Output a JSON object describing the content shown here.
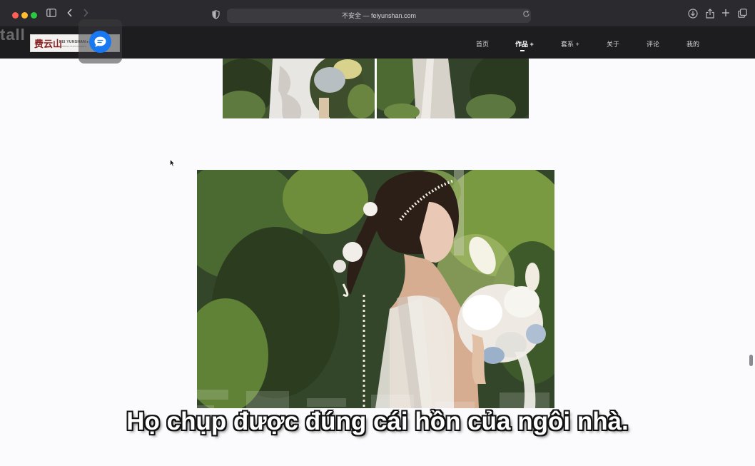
{
  "browser": {
    "url_text": "不安全 — feiyunshan.com",
    "icons": [
      "sidebar-icon",
      "back-icon",
      "forward-icon",
      "shield-icon",
      "reload-icon",
      "download-icon",
      "share-icon",
      "new-tab-icon",
      "tabs-overview-icon"
    ]
  },
  "site": {
    "overlay_text": "tall",
    "logo": {
      "cn": "费云山",
      "en": "FEI YUNSHAN ▸ ◆ ◆ ◆",
      "sub": "WEDDING PHOTOGRAPHY"
    },
    "nav": [
      {
        "label": "首页"
      },
      {
        "label": "作品 +"
      },
      {
        "label": "套系 +"
      },
      {
        "label": "关于"
      },
      {
        "label": "评论"
      },
      {
        "label": "我的"
      }
    ],
    "active_nav": "作品 +"
  },
  "subtitle": "Họ chụp được đúng cái hồn của ngôi nhà.",
  "colors": {
    "header_bg": "#1d1c1f",
    "page_bg": "#fbfafc",
    "chat_button": "#1778f2"
  }
}
